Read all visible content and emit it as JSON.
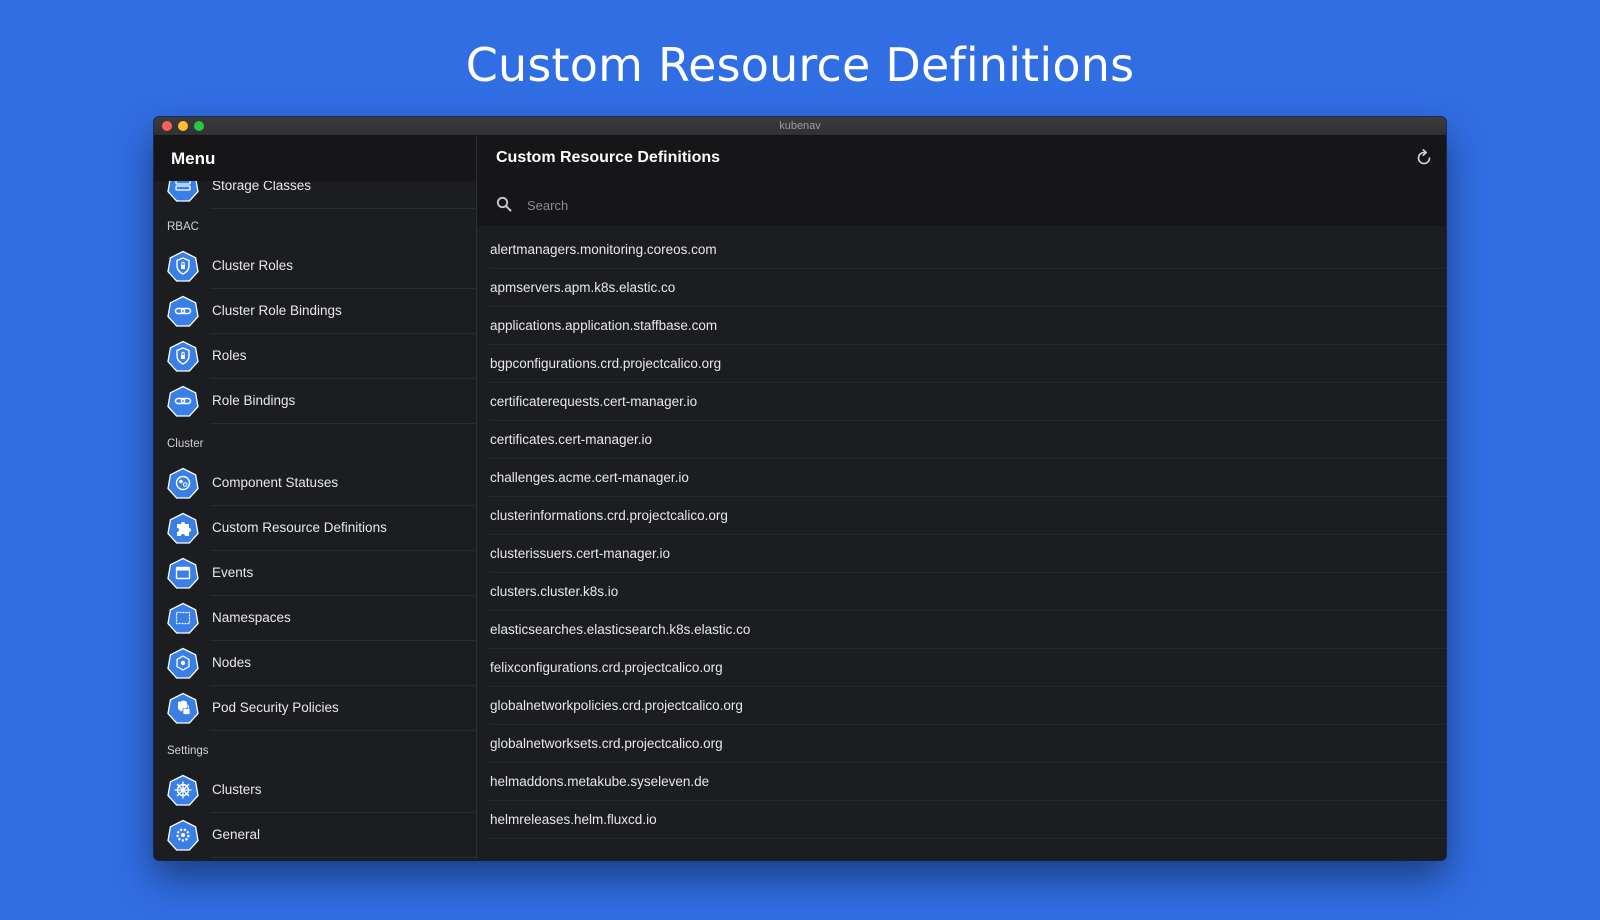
{
  "hero_title": "Custom Resource Definitions",
  "window": {
    "title": "kubenav"
  },
  "sidebar": {
    "title": "Menu",
    "partial_item": {
      "label": "Storage Classes",
      "icon": "storage-classes-icon"
    },
    "sections": [
      {
        "label": "RBAC",
        "items": [
          {
            "label": "Cluster Roles",
            "icon": "shield-icon"
          },
          {
            "label": "Cluster Role Bindings",
            "icon": "link-icon"
          },
          {
            "label": "Roles",
            "icon": "shield-icon"
          },
          {
            "label": "Role Bindings",
            "icon": "link-icon"
          }
        ]
      },
      {
        "label": "Cluster",
        "items": [
          {
            "label": "Component Statuses",
            "icon": "component-statuses-icon"
          },
          {
            "label": "Custom Resource Definitions",
            "icon": "puzzle-icon"
          },
          {
            "label": "Events",
            "icon": "calendar-icon"
          },
          {
            "label": "Namespaces",
            "icon": "namespace-icon"
          },
          {
            "label": "Nodes",
            "icon": "node-icon"
          },
          {
            "label": "Pod Security Policies",
            "icon": "pod-security-icon"
          }
        ]
      },
      {
        "label": "Settings",
        "items": [
          {
            "label": "Clusters",
            "icon": "helm-wheel-icon"
          },
          {
            "label": "General",
            "icon": "gear-icon"
          }
        ]
      }
    ]
  },
  "main": {
    "title": "Custom Resource Definitions",
    "refresh_icon": "refresh-icon",
    "search": {
      "placeholder": "Search",
      "value": ""
    },
    "items": [
      "alertmanagers.monitoring.coreos.com",
      "apmservers.apm.k8s.elastic.co",
      "applications.application.staffbase.com",
      "bgpconfigurations.crd.projectcalico.org",
      "certificaterequests.cert-manager.io",
      "certificates.cert-manager.io",
      "challenges.acme.cert-manager.io",
      "clusterinformations.crd.projectcalico.org",
      "clusterissuers.cert-manager.io",
      "clusters.cluster.k8s.io",
      "elasticsearches.elasticsearch.k8s.elastic.co",
      "felixconfigurations.crd.projectcalico.org",
      "globalnetworkpolicies.crd.projectcalico.org",
      "globalnetworksets.crd.projectcalico.org",
      "helmaddons.metakube.syseleven.de",
      "helmreleases.helm.fluxcd.io"
    ]
  },
  "colors": {
    "background": "#316ee4",
    "icon_blue": "#3a7fe6",
    "window_bg": "#1c1d20",
    "header_bg": "#161618"
  }
}
